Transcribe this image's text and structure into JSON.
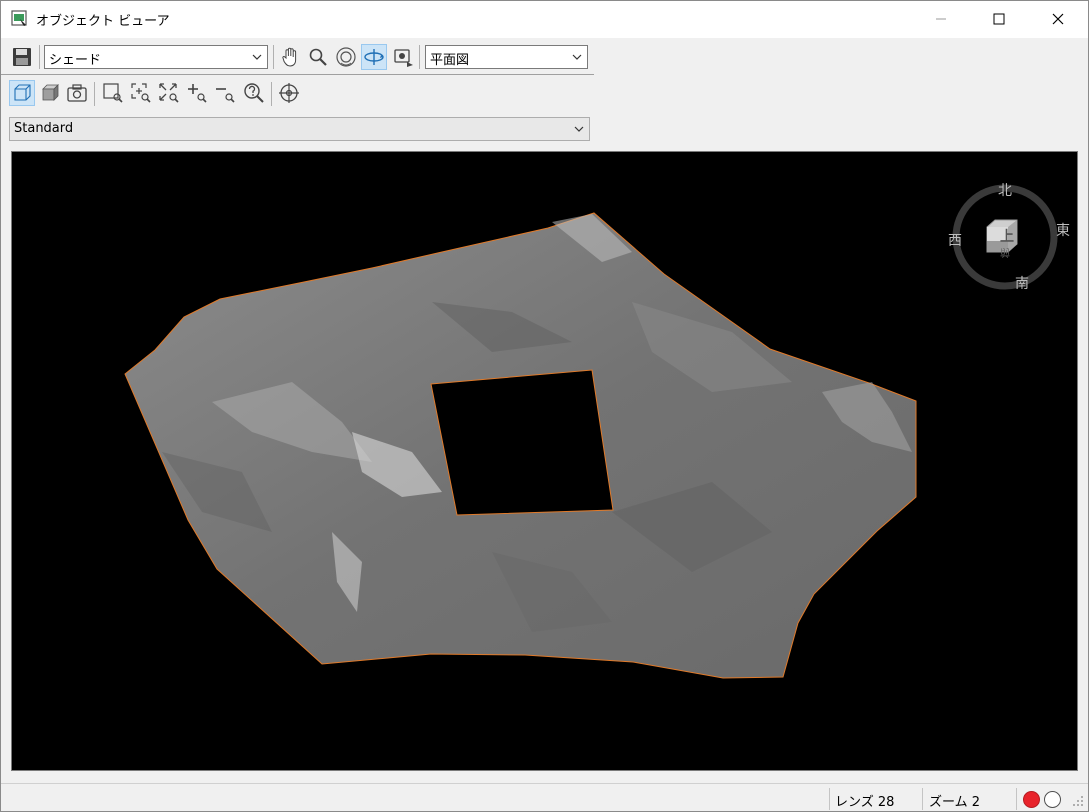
{
  "window": {
    "title": "オブジェクト ビューア"
  },
  "toolbar1": {
    "shading_value": "シェード",
    "view_value": "平面図"
  },
  "toolbar2": {
    "style_value": "Standard"
  },
  "compass": {
    "north": "北",
    "south": "南",
    "east": "東",
    "west": "西",
    "cube_top": "上",
    "cube_front": "前"
  },
  "status": {
    "lens": "レンズ 28",
    "zoom": "ズーム 2"
  },
  "colors": {
    "surface": "#7a7a7a",
    "boundary": "#e07a2a",
    "viewport_bg": "#000000",
    "active_button": "#cce4f7",
    "status_red": "#e8232b"
  }
}
